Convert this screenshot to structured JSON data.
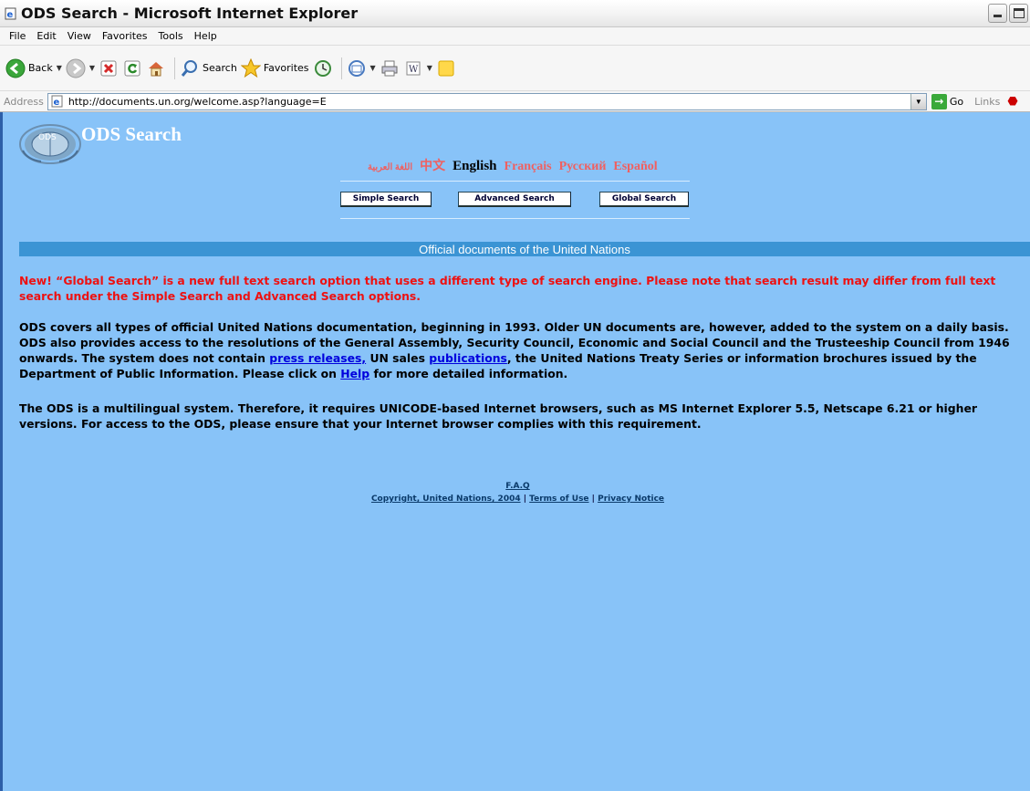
{
  "window": {
    "title": "ODS Search - Microsoft Internet Explorer"
  },
  "menu": [
    "File",
    "Edit",
    "View",
    "Favorites",
    "Tools",
    "Help"
  ],
  "toolbar": {
    "back_label": "Back",
    "search_label": "Search",
    "favorites_label": "Favorites"
  },
  "address": {
    "label": "Address",
    "url": "http://documents.un.org/welcome.asp?language=E",
    "go_label": "Go",
    "links_label": "Links"
  },
  "page": {
    "site_title": "ODS Search",
    "languages": {
      "arabic": "اللغة العربية",
      "chinese": "中文",
      "english": "English",
      "french": "Français",
      "russian": "Русский",
      "spanish": "Español"
    },
    "buttons": {
      "simple": "Simple Search",
      "advanced": "Advanced Search",
      "global": "Global Search"
    },
    "section_title": "Official documents of the United Nations",
    "notice": "New! “Global Search” is a new full text search option that uses a different type of search engine. Please note that search result may differ from full text search under the Simple Search and Advanced Search options.",
    "para1": {
      "part1": "ODS covers all types of official United Nations documentation, beginning in 1993. Older UN documents are, however, added to the system on a daily basis. ODS also provides access to the resolutions of the General Assembly, Security Council, Economic and Social Council and the Trusteeship Council from 1946 onwards. The system does not contain ",
      "link_press": "press releases,",
      "part2": " UN sales ",
      "link_publications": "publications",
      "part3": ", the United Nations Treaty Series or information brochures issued by the Department of Public Information. Please click on ",
      "link_help": "Help",
      "part4": " for more detailed information."
    },
    "para2": "The ODS is a multilingual system. Therefore, it requires UNICODE-based Internet browsers, such as MS Internet Explorer 5.5, Netscape 6.21 or higher versions. For access to the ODS, please ensure that your Internet browser complies with this requirement.",
    "footer": {
      "faq": "F.A.Q",
      "copyright": "Copyright, United Nations, 2004",
      "divider": " | ",
      "terms": "Terms of Use",
      "privacy": "Privacy Notice"
    }
  }
}
